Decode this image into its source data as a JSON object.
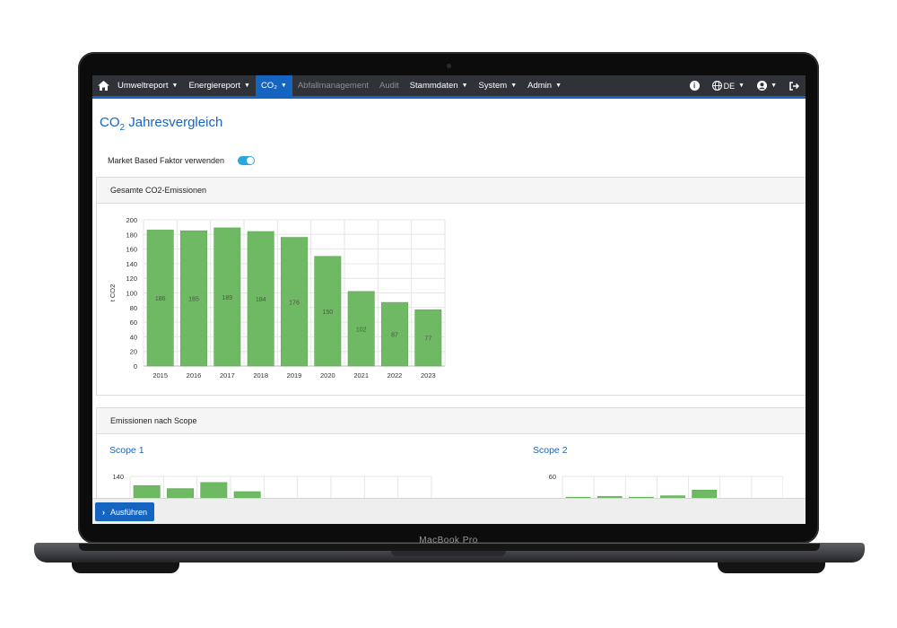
{
  "device": {
    "label": "MacBook Pro"
  },
  "navbar": {
    "home_icon": "home-icon",
    "items": [
      {
        "label": "Umweltreport",
        "dropdown": true
      },
      {
        "label": "Energiereport",
        "dropdown": true
      },
      {
        "label": "CO₂",
        "dropdown": true,
        "active": true
      },
      {
        "label": "Abfallmanagement",
        "disabled": true
      },
      {
        "label": "Audit",
        "disabled": true
      },
      {
        "label": "Stammdaten",
        "dropdown": true
      },
      {
        "label": "System",
        "dropdown": true
      },
      {
        "label": "Admin",
        "dropdown": true
      }
    ],
    "info_icon": "info-icon",
    "language": "DE",
    "user_icon": "user-icon",
    "logout_icon": "logout-icon"
  },
  "page": {
    "title_main": "CO",
    "title_sub": "2",
    "title_rest": " Jahresvergleich"
  },
  "toggle": {
    "label": "Market Based Faktor verwenden",
    "checked": true
  },
  "card_total": {
    "header": "Gesamte CO2-Emissionen"
  },
  "card_scope": {
    "header": "Emissionen nach Scope",
    "scope1_title": "Scope 1",
    "scope2_title": "Scope 2"
  },
  "footer": {
    "run_label": "Ausführen"
  },
  "colors": {
    "accent": "#1565c0",
    "navbar": "#2f3338",
    "bar": "#6fb864",
    "bar_border": "#5fa854"
  },
  "chart_data": [
    {
      "type": "bar",
      "ylabel": "t CO2",
      "categories": [
        "2015",
        "2016",
        "2017",
        "2018",
        "2019",
        "2020",
        "2021",
        "2022",
        "2023"
      ],
      "values": [
        186,
        185,
        189,
        184,
        176,
        150,
        102,
        87,
        77
      ],
      "ylim": [
        0,
        200
      ],
      "yticks": [
        0,
        20,
        40,
        60,
        80,
        100,
        120,
        140,
        160,
        180,
        200
      ],
      "grid": true,
      "data_labels": true
    },
    {
      "type": "bar",
      "title": "Scope 1",
      "visible_ytick": 140,
      "partial": true,
      "values": [
        134,
        132,
        136,
        130
      ]
    },
    {
      "type": "bar",
      "title": "Scope 2",
      "visible_ytick": 60,
      "partial": true,
      "values": [
        31,
        32,
        31,
        33,
        41
      ]
    }
  ]
}
